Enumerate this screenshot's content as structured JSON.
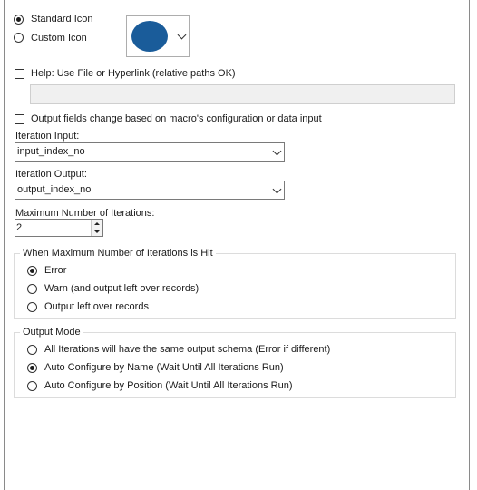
{
  "icon": {
    "standard_label": "Standard Icon",
    "custom_label": "Custom Icon",
    "selected": "standard",
    "icon_color": "#1a5c9a"
  },
  "help": {
    "label": "Help: Use File or Hyperlink (relative paths OK)",
    "checked": false,
    "value": ""
  },
  "output_fields": {
    "label": "Output fields change based on macro's configuration or data input",
    "checked": false
  },
  "iteration_input": {
    "label": "Iteration Input:",
    "value": "input_index_no"
  },
  "iteration_output": {
    "label": "Iteration Output:",
    "value": "output_index_no"
  },
  "max_iterations": {
    "label": "Maximum Number of Iterations:",
    "value": "2"
  },
  "max_hit_group": {
    "legend": "When Maximum Number of Iterations is Hit",
    "options": [
      "Error",
      "Warn (and output left over records)",
      "Output left over records"
    ],
    "selected_index": 0
  },
  "output_mode_group": {
    "legend": "Output Mode",
    "options": [
      "All Iterations will have the same output schema (Error if different)",
      "Auto Configure by Name (Wait Until All Iterations Run)",
      "Auto Configure by Position (Wait Until All Iterations Run)"
    ],
    "selected_index": 1
  }
}
